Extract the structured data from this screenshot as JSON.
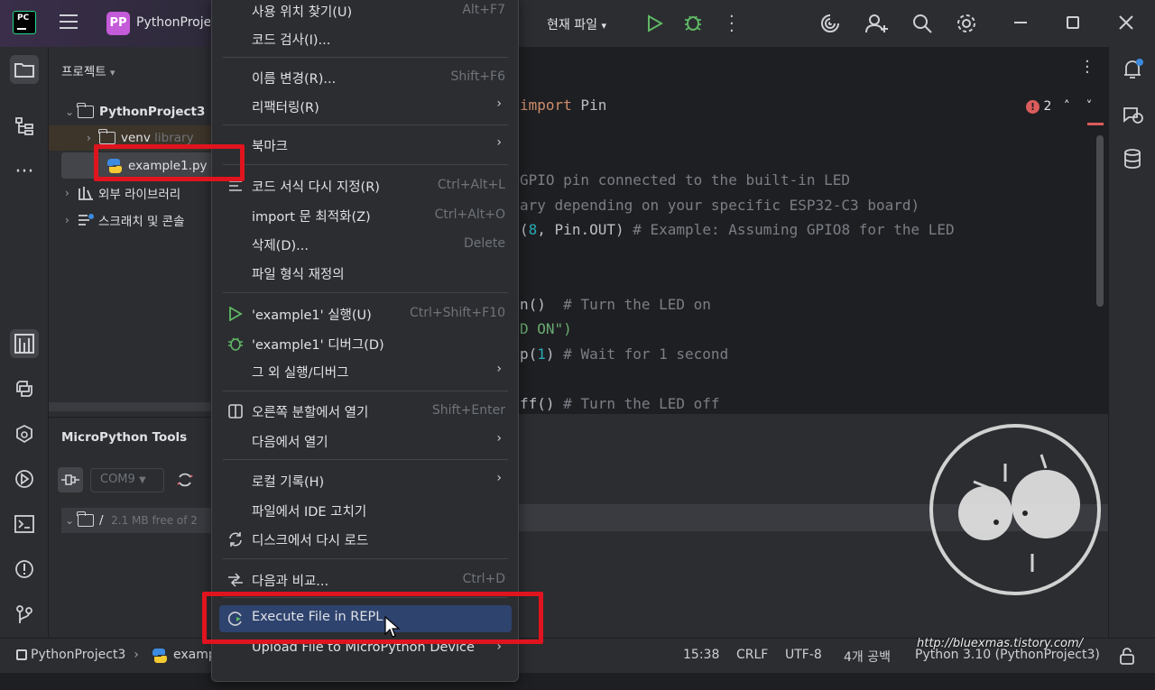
{
  "titlebar": {
    "project_badge": "PP",
    "project_name": "PythonProje",
    "run_config": "현재 파일",
    "logo": "PC"
  },
  "project_panel": {
    "title": "프로젝트",
    "root": "PythonProject3",
    "venv": "venv",
    "venv_hint": "library",
    "file": "example1.py",
    "external": "외부 라이브러리",
    "scratch": "스크래치 및 콘솔"
  },
  "micropython": {
    "title": "MicroPython Tools",
    "port": "COM9",
    "fs_root": "/",
    "fs_info": "2.1 MB free of 2"
  },
  "editor": {
    "lines": [
      {
        "parts": [
          {
            "t": "import",
            "c": "kw"
          },
          {
            "t": " Pin",
            "c": ""
          }
        ]
      },
      {
        "parts": [
          {
            "t": "GPIO pin connected to the built-in LED",
            "c": "cm"
          }
        ]
      },
      {
        "parts": [
          {
            "t": "ary depending on your specific ESP32-C3 board)",
            "c": "cm"
          }
        ]
      },
      {
        "parts": [
          {
            "t": "(",
            "c": ""
          },
          {
            "t": "8",
            "c": "num"
          },
          {
            "t": ", Pin.OUT) ",
            "c": ""
          },
          {
            "t": "# Example: Assuming GPIO8 for the LED",
            "c": "cm"
          }
        ]
      },
      {
        "parts": [
          {
            "t": "n()  ",
            "c": ""
          },
          {
            "t": "# Turn the LED on",
            "c": "cm"
          }
        ]
      },
      {
        "parts": [
          {
            "t": "D ON\")",
            "c": "str"
          }
        ]
      },
      {
        "parts": [
          {
            "t": "p(",
            "c": ""
          },
          {
            "t": "1",
            "c": "num"
          },
          {
            "t": ") ",
            "c": ""
          },
          {
            "t": "# Wait for 1 second",
            "c": "cm"
          }
        ]
      },
      {
        "parts": [
          {
            "t": "ff() ",
            "c": ""
          },
          {
            "t": "# Turn the LED off",
            "c": "cm"
          }
        ]
      }
    ],
    "error_count": "2"
  },
  "context_menu": {
    "items": [
      {
        "label": "사용 위치 찾기(U)",
        "shortcut": "Alt+F7"
      },
      {
        "label": "코드 검사(I)...",
        "shortcut": ""
      },
      {
        "label": "이름 변경(R)...",
        "shortcut": "Shift+F6"
      },
      {
        "label": "리팩터링(R)",
        "shortcut": ""
      },
      {
        "label": "북마크",
        "shortcut": ""
      },
      {
        "label": "코드 서식 다시 지정(R)",
        "shortcut": "Ctrl+Alt+L"
      },
      {
        "label": "import 문 최적화(Z)",
        "shortcut": "Ctrl+Alt+O"
      },
      {
        "label": "삭제(D)...",
        "shortcut": "Delete"
      },
      {
        "label": "파일 형식 재정의",
        "shortcut": ""
      },
      {
        "label": "'example1' 실행(U)",
        "shortcut": "Ctrl+Shift+F10"
      },
      {
        "label": "'example1' 디버그(D)",
        "shortcut": ""
      },
      {
        "label": "그 외 실행/디버그",
        "shortcut": ""
      },
      {
        "label": "오른쪽 분할에서 열기",
        "shortcut": "Shift+Enter"
      },
      {
        "label": "다음에서 열기",
        "shortcut": ""
      },
      {
        "label": "로컬 기록(H)",
        "shortcut": ""
      },
      {
        "label": "파일에서 IDE 고치기",
        "shortcut": ""
      },
      {
        "label": "디스크에서 다시 로드",
        "shortcut": ""
      },
      {
        "label": "다음과 비교...",
        "shortcut": "Ctrl+D"
      },
      {
        "label": "Execute File in REPL",
        "shortcut": ""
      },
      {
        "label": "Upload File to MicroPython Device",
        "shortcut": ""
      }
    ]
  },
  "statusbar": {
    "crumb_project": "PythonProject3",
    "crumb_file": "examp",
    "position": "15:38",
    "line_sep": "CRLF",
    "encoding": "UTF-8",
    "indent": "4개 공백",
    "interpreter": "Python 3.10 (PythonProject3)"
  },
  "watermark": "http://bluexmas.tistory.com/"
}
